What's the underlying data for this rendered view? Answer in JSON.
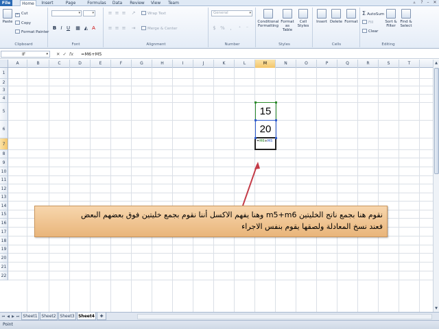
{
  "tabs": [
    "File",
    "Home",
    "Insert",
    "Page Layout",
    "Formulas",
    "Data",
    "Review",
    "View",
    "Team"
  ],
  "active_tab": "Home",
  "ribbon": {
    "clipboard": {
      "paste": "Paste",
      "cut": "Cut",
      "copy": "Copy",
      "format_painter": "Format Painter",
      "label": "Clipboard"
    },
    "font": {
      "label": "Font",
      "bold": "B",
      "italic": "I",
      "underline": "U",
      "font_color": "A"
    },
    "alignment": {
      "wrap_text": "Wrap Text",
      "merge_center": "Merge & Center",
      "label": "Alignment"
    },
    "number": {
      "format": "General",
      "percent": "%",
      "comma": ",",
      "label": "Number",
      "currency": "$"
    },
    "styles": {
      "conditional": "Conditional",
      "conditional2": "Formatting",
      "format_as": "Format",
      "format_as2": "as Table",
      "cell_styles": "Cell",
      "cell_styles2": "Styles",
      "label": "Styles"
    },
    "cells": {
      "insert": "Insert",
      "delete": "Delete",
      "format": "Format",
      "label": "Cells"
    },
    "editing": {
      "autosum": "AutoSum",
      "fill": "Fill",
      "clear": "Clear",
      "sort": "Sort &",
      "sort2": "Filter",
      "find": "Find &",
      "find2": "Select",
      "label": "Editing"
    }
  },
  "formula_bar": {
    "name_box": "IF",
    "cancel": "✕",
    "enter": "✓",
    "fx": "fx",
    "formula": "=M6+M5"
  },
  "columns": [
    "A",
    "B",
    "C",
    "D",
    "E",
    "F",
    "G",
    "H",
    "I",
    "J",
    "K",
    "L",
    "M",
    "N",
    "O",
    "P",
    "Q",
    "R",
    "S",
    "T"
  ],
  "rows": [
    "1",
    "2",
    "3",
    "4",
    "5",
    "6",
    "7",
    "8",
    "9",
    "10",
    "11",
    "12",
    "13",
    "14",
    "15",
    "16",
    "17",
    "18",
    "19",
    "20",
    "21",
    "22"
  ],
  "cells": {
    "m5": "15",
    "m6": "20",
    "m7_eq": "=",
    "m7_ref1": "M6",
    "m7_plus": "+",
    "m7_ref2": "M5"
  },
  "callout": {
    "line1": "نقوم هنا بجمع ناتج الخليتين m5+m6 وهنا يفهم الاكسل أننا نقوم بجمع خليتين فوق بعضهم البعض",
    "line2": "فعند نسخ المعادلة ولصقها يقوم بنفس الاجراء"
  },
  "sheets": [
    "Sheet1",
    "Sheet2",
    "Sheet3",
    "Sheet4"
  ],
  "active_sheet": "Sheet4",
  "status": "Point",
  "colors": {
    "file_tab": "#2a6ab4",
    "ref1": "#2c8a2c",
    "ref2": "#2f5ccc",
    "callout": "#efc391",
    "arrow": "#c43c48"
  }
}
